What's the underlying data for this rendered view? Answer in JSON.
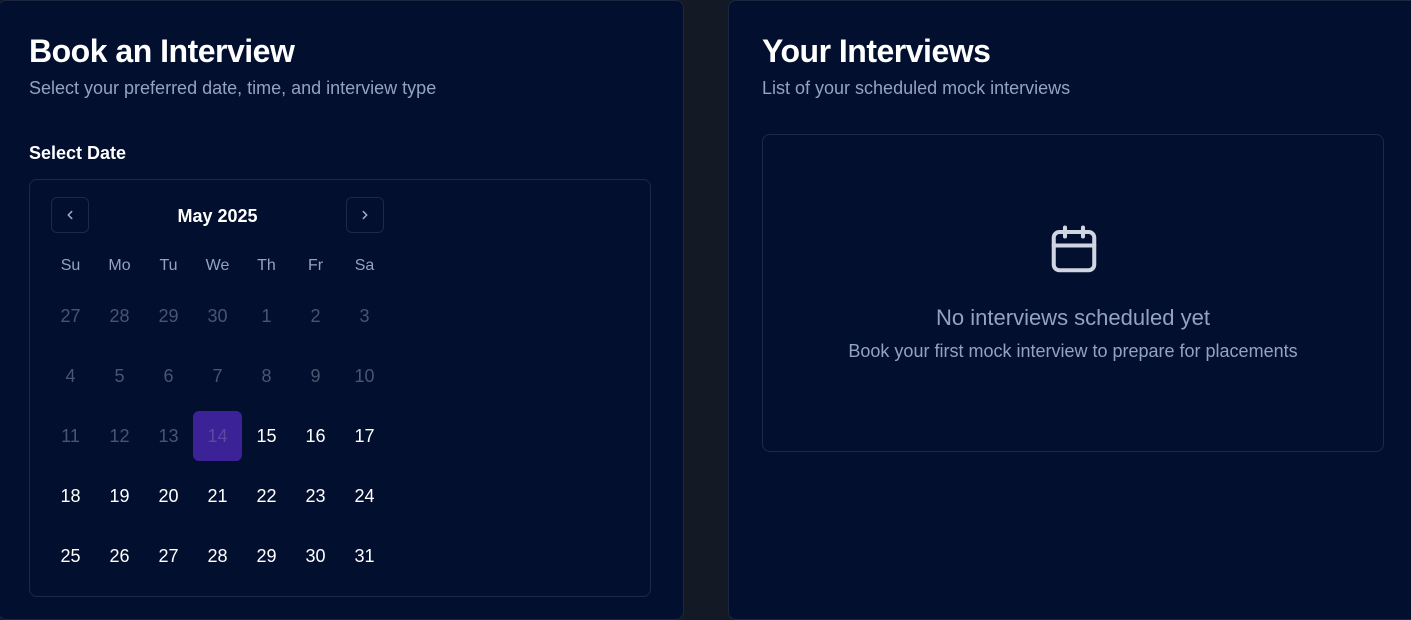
{
  "booking": {
    "title": "Book an Interview",
    "subtitle": "Select your preferred date, time, and interview type",
    "date_label": "Select Date",
    "calendar": {
      "month_label": "May 2025",
      "prev_icon": "chevron-left-icon",
      "next_icon": "chevron-right-icon",
      "weekdays": [
        "Su",
        "Mo",
        "Tu",
        "We",
        "Th",
        "Fr",
        "Sa"
      ],
      "weeks": [
        [
          "27",
          "28",
          "29",
          "30",
          "1",
          "2",
          "3"
        ],
        [
          "4",
          "5",
          "6",
          "7",
          "8",
          "9",
          "10"
        ],
        [
          "11",
          "12",
          "13",
          "14",
          "15",
          "16",
          "17"
        ],
        [
          "18",
          "19",
          "20",
          "21",
          "22",
          "23",
          "24"
        ],
        [
          "25",
          "26",
          "27",
          "28",
          "29",
          "30",
          "31"
        ]
      ],
      "disabled": [
        [
          true,
          true,
          true,
          true,
          true,
          true,
          true
        ],
        [
          true,
          true,
          true,
          true,
          true,
          true,
          true
        ],
        [
          true,
          true,
          true,
          true,
          false,
          false,
          false
        ],
        [
          false,
          false,
          false,
          false,
          false,
          false,
          false
        ],
        [
          false,
          false,
          false,
          false,
          false,
          false,
          false
        ]
      ],
      "selected_day": "14",
      "selected_color": "#3b2297"
    }
  },
  "interviews": {
    "title": "Your Interviews",
    "subtitle": "List of your scheduled mock interviews",
    "empty": {
      "icon": "calendar-icon",
      "title": "No interviews scheduled yet",
      "subtitle": "Book your first mock interview to prepare for placements"
    }
  },
  "colors": {
    "page_bg": "#131925",
    "panel_bg": "#020f2e",
    "muted_text": "#94a3c0",
    "accent": "#3b2297"
  }
}
